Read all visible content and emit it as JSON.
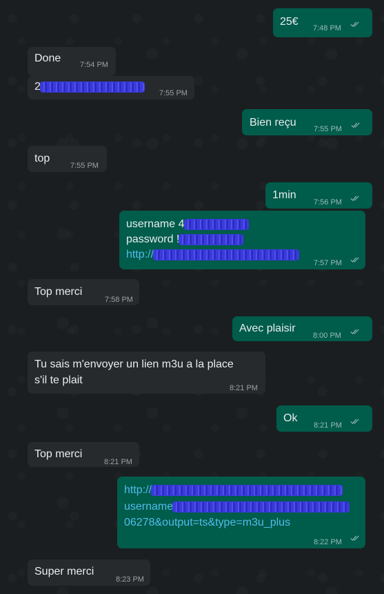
{
  "chat": {
    "messages": [
      {
        "dir": "out",
        "text": "25€",
        "time": "7:48 PM"
      },
      {
        "dir": "in",
        "text": "Done",
        "time": "7:54 PM"
      },
      {
        "dir": "in",
        "text": "2",
        "time": "7:55 PM"
      },
      {
        "dir": "out",
        "text": "Bien reçu",
        "time": "7:55 PM"
      },
      {
        "dir": "in",
        "text": "top",
        "time": "7:55 PM"
      },
      {
        "dir": "out",
        "text": "1min",
        "time": "7:56 PM"
      },
      {
        "dir": "out",
        "line1": "username 4",
        "line2": "password !",
        "line3": "http://",
        "time": "7:57 PM"
      },
      {
        "dir": "in",
        "text": "Top merci",
        "time": "7:58 PM"
      },
      {
        "dir": "out",
        "text": "Avec plaisir",
        "time": "8:00 PM"
      },
      {
        "dir": "in",
        "line1": "Tu sais m'envoyer un lien m3u a la place",
        "line2": "s'il te plait",
        "time": "8:21 PM"
      },
      {
        "dir": "out",
        "text": "Ok",
        "time": "8:21 PM"
      },
      {
        "dir": "in",
        "text": "Top merci",
        "time": "8:21 PM"
      },
      {
        "dir": "out",
        "line1": "http://",
        "line2": "username",
        "line3": "06278&output=ts&type=m3u_plus",
        "time": "8:22 PM"
      },
      {
        "dir": "in",
        "text": "Super merci",
        "time": "8:23 PM"
      }
    ]
  },
  "icons": {
    "read_receipt": "double-check-icon"
  },
  "colors": {
    "incoming_bubble": "#262a2c",
    "outgoing_bubble": "#005c4b",
    "link": "#53bdeb",
    "background": "#1b1e20"
  }
}
